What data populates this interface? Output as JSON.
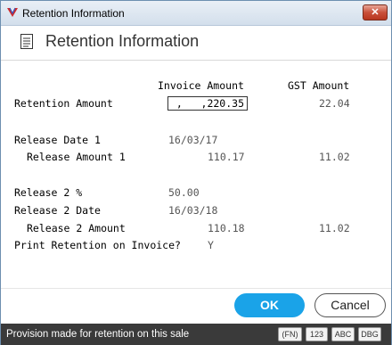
{
  "window": {
    "title": "Retention Information",
    "close_label": "✕"
  },
  "header": {
    "title": "Retention Information"
  },
  "columns": {
    "invoice_amount": "Invoice Amount",
    "gst_amount": "GST Amount"
  },
  "rows": {
    "retention_amount": {
      "label": "Retention Amount",
      "input_value": ",   ,220.35",
      "gst": "22.04"
    },
    "release_date_1": {
      "label": "Release Date 1",
      "value": "16/03/17"
    },
    "release_amount_1": {
      "label": "Release Amount 1",
      "amount": "110.17",
      "gst": "11.02"
    },
    "release_2_pct": {
      "label": "Release 2 %",
      "value": "50.00"
    },
    "release_2_date": {
      "label": "Release 2 Date",
      "value": "16/03/18"
    },
    "release_2_amount": {
      "label": "Release 2 Amount",
      "amount": "110.18",
      "gst": "11.02"
    },
    "print_retention": {
      "label": "Print Retention on Invoice?",
      "value": "Y"
    }
  },
  "buttons": {
    "ok": "OK",
    "cancel": "Cancel"
  },
  "status": {
    "message": "Provision made for retention on this sale",
    "badges": [
      "(FN)",
      "123",
      "ABC",
      "DBG"
    ]
  },
  "colors": {
    "accent": "#1aa3e8",
    "statusbar": "#3a3a3a"
  }
}
